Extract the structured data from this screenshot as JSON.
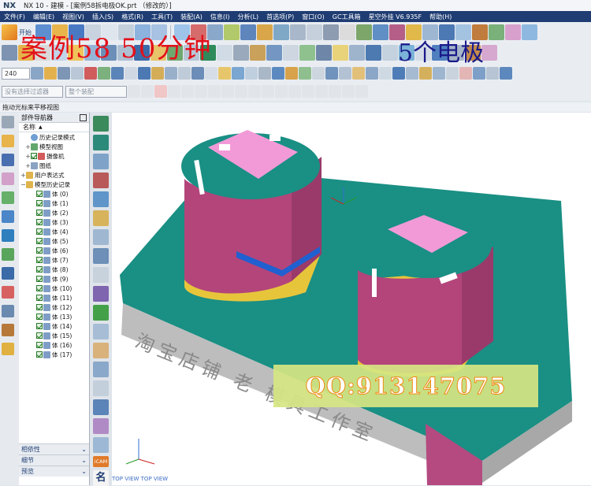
{
  "titlebar": {
    "logo": "NX",
    "title": "NX 10 - 建模 - [案例58拆电极OK.prt （修改的）]"
  },
  "menubar": {
    "items": [
      "文件(F)",
      "编辑(E)",
      "视图(V)",
      "插入(S)",
      "格式(R)",
      "工具(T)",
      "装配(A)",
      "信息(I)",
      "分析(L)",
      "首选项(P)",
      "窗口(O)",
      "GC工具箱",
      "星空外挂 V6.935F",
      "帮助(H)"
    ]
  },
  "overlay": {
    "title": "案例58  50分钟",
    "right": "5个电极"
  },
  "toolbar": {
    "start_label": "开始",
    "combo_value": "240",
    "selection_filter_placeholder": "没有选择过滤器",
    "assembly_filter": "整个装配"
  },
  "statusline": {
    "text": "拖动光标来平移视图"
  },
  "navigator": {
    "title": "部件导航器",
    "column": "名称",
    "nodes": [
      {
        "label": "历史记录模式",
        "indent": 1
      },
      {
        "label": "模型视图",
        "indent": 1
      },
      {
        "label": "摄像机",
        "indent": 1
      },
      {
        "label": "图纸",
        "indent": 1
      },
      {
        "label": "用户表达式",
        "indent": 0
      },
      {
        "label": "模型历史记录",
        "indent": 0
      }
    ],
    "bodies": [
      "体 (0)",
      "体 (1)",
      "体 (2)",
      "体 (3)",
      "体 (4)",
      "体 (5)",
      "体 (6)",
      "体 (7)",
      "体 (8)",
      "体 (9)",
      "体 (10)",
      "体 (11)",
      "体 (12)",
      "体 (13)",
      "体 (14)",
      "体 (15)",
      "体 (16)",
      "体 (17)"
    ],
    "bottom_tabs": [
      "相依性",
      "细节",
      "预览"
    ]
  },
  "viewport": {
    "engraving": "淘宝店铺 老 模具工作室",
    "qq_text": "QQ:913147075",
    "bottom_labels": "TOP VIEW   TOP VIEW"
  },
  "colors": {
    "menubar": "#1f3d73",
    "teal": "#1a8f84",
    "magenta": "#b3457b",
    "pink": "#f29ad8",
    "overlay_red": "#e3101a",
    "qq_bg": "#d6e682"
  },
  "sidetool": {
    "icam_label": "iCAM",
    "name_label": "名"
  }
}
